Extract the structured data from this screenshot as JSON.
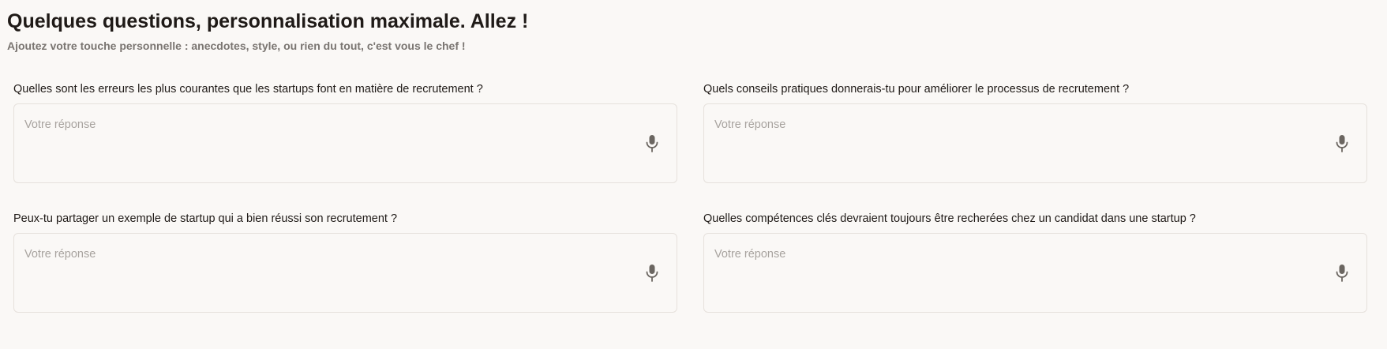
{
  "header": {
    "title": "Quelques questions, personnalisation maximale. Allez !",
    "subtitle": "Ajoutez votre touche personnelle : anecdotes, style, ou rien du tout, c'est vous le chef !"
  },
  "questions": [
    {
      "label": "Quelles sont les erreurs les plus courantes que les startups font en matière de recrutement ?",
      "placeholder": "Votre réponse",
      "value": ""
    },
    {
      "label": "Quels conseils pratiques donnerais-tu pour améliorer le processus de recrutement ?",
      "placeholder": "Votre réponse",
      "value": ""
    },
    {
      "label": "Peux-tu partager un exemple de startup qui a bien réussi son recrutement ?",
      "placeholder": "Votre réponse",
      "value": ""
    },
    {
      "label": "Quelles compétences clés devraient toujours être recherées chez un candidat dans une startup ?",
      "placeholder": "Votre réponse",
      "value": ""
    }
  ],
  "icons": {
    "mic": "microphone-icon"
  },
  "colors": {
    "background": "#faf8f6",
    "text": "#1f1a17",
    "subtitle": "#7a7571",
    "placeholder": "#a8a39f",
    "border": "#e6e1dc",
    "icon": "#6b6661"
  }
}
